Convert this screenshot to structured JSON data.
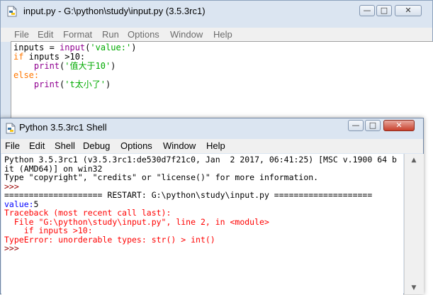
{
  "colors": {
    "keyword": "#ff7700",
    "builtin": "#900090",
    "string": "#00aa00",
    "stdout": "#0000ff",
    "stderr": "#ff0000",
    "prompt": "#990000",
    "title_bar": "#dbe5f1"
  },
  "editor": {
    "title": "input.py - G:\\python\\study\\input.py (3.5.3rc1)",
    "icon": "python-file-icon",
    "menu": [
      "File",
      "Edit",
      "Format",
      "Run",
      "Options",
      "Window",
      "Help"
    ],
    "code": {
      "l1_var": "inputs = ",
      "l1_fn": "input",
      "l1_open": "(",
      "l1_str": "'value:'",
      "l1_close": ")",
      "l2_kw": "if",
      "l2_rest": " inputs >10:",
      "l3_indent": "    ",
      "l3_fn": "print",
      "l3_open": "(",
      "l3_str": "'值大于10'",
      "l3_close": ")",
      "l4_kw": "else:",
      "l5_indent": "    ",
      "l5_fn": "print",
      "l5_open": "(",
      "l5_str": "'t太小了'",
      "l5_close": ")"
    }
  },
  "shell": {
    "title": "Python 3.5.3rc1 Shell",
    "icon": "python-shell-icon",
    "menu": [
      "File",
      "Edit",
      "Shell",
      "Debug",
      "Options",
      "Window",
      "Help"
    ],
    "lines": {
      "banner1": "Python 3.5.3rc1 (v3.5.3rc1:de530d7f21c0, Jan  2 2017, 06:41:25) [MSC v.1900 64 b",
      "banner2": "it (AMD64)] on win32",
      "banner3": "Type \"copyright\", \"credits\" or \"license()\" for more information.",
      "prompt1": ">>> ",
      "restart": "==================== RESTART: G:\\python\\study\\input.py ====================",
      "input_prompt": "value:",
      "input_value": "5",
      "tb1": "Traceback (most recent call last):",
      "tb2": "  File \"G:\\python\\study\\input.py\", line 2, in <module>",
      "tb3": "    if inputs >10:",
      "tb4": "TypeError: unorderable types: str() > int()",
      "prompt2": ">>> "
    }
  },
  "window_buttons": {
    "minimize": "—",
    "maximize": "□",
    "close": "✕"
  }
}
